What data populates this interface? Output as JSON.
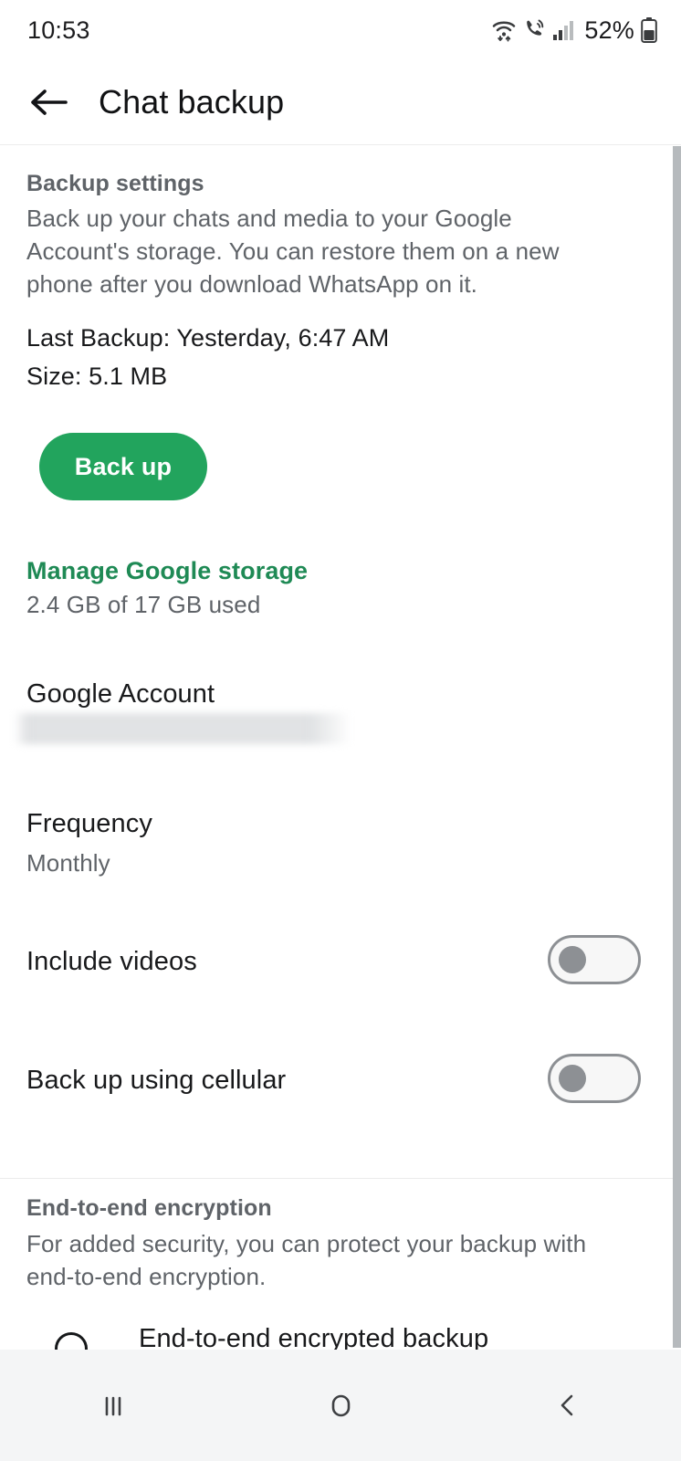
{
  "status_bar": {
    "time": "10:53",
    "battery_percent": "52%",
    "icons": [
      "wifi-icon",
      "call-icon",
      "cellular-signal-icon",
      "battery-icon"
    ]
  },
  "app_bar": {
    "back_icon": "back-arrow-icon",
    "title": "Chat backup"
  },
  "backup_section": {
    "header": "Backup settings",
    "description": "Back up your chats and media to your Google Account's storage. You can restore them on a new phone after you download WhatsApp on it.",
    "last_backup": "Last Backup: Yesterday, 6:47 AM",
    "size": "Size: 5.1 MB",
    "backup_button": "Back up",
    "manage_storage_link": "Manage Google storage",
    "storage_usage": "2.4 GB of 17 GB used"
  },
  "google_account": {
    "label": "Google Account",
    "value": ""
  },
  "frequency": {
    "label": "Frequency",
    "value": "Monthly"
  },
  "toggles": [
    {
      "label": "Include videos",
      "state": "off"
    },
    {
      "label": "Back up using cellular",
      "state": "off"
    }
  ],
  "encryption_section": {
    "header": "End-to-end encryption",
    "description": "For added security, you can protect your backup with end-to-end encryption.",
    "row_label": "End-to-end encrypted backup"
  },
  "nav_bar": {
    "recents": "recents-icon",
    "home": "home-icon",
    "back": "back-icon"
  },
  "colors": {
    "accent_green": "#22a45d",
    "link_green": "#1f8a55",
    "text_primary": "#18191b",
    "text_secondary": "#5f6368"
  }
}
